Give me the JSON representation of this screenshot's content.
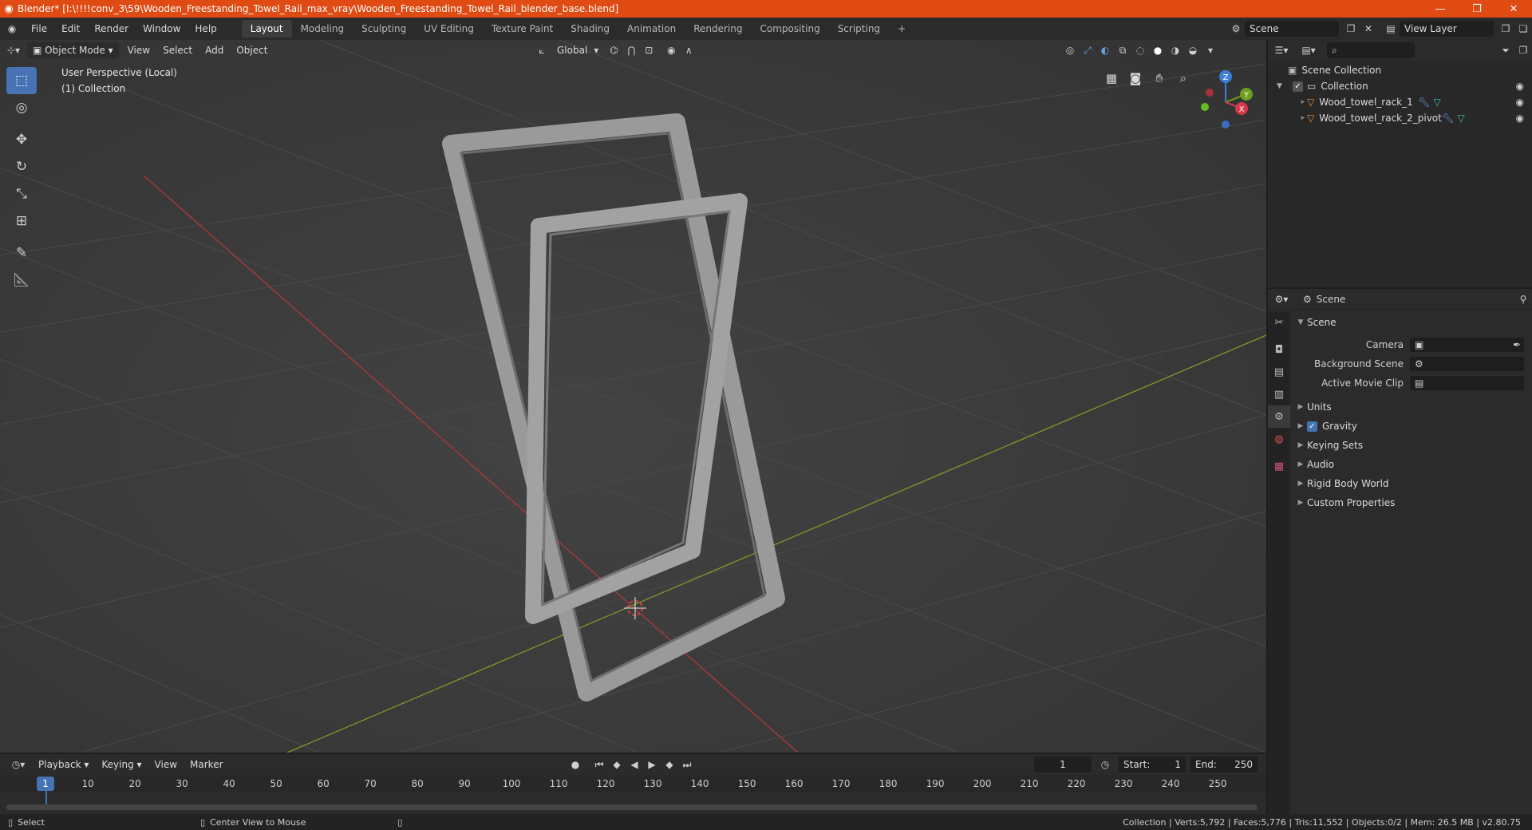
{
  "window": {
    "title": "Blender* [I:\\!!!!conv_3\\59\\Wooden_Freestanding_Towel_Rail_max_vray\\Wooden_Freestanding_Towel_Rail_blender_base.blend]",
    "minimize": "—",
    "maximize": "❐",
    "close": "✕"
  },
  "menu": [
    "File",
    "Edit",
    "Render",
    "Window",
    "Help"
  ],
  "workspaces": [
    "Layout",
    "Modeling",
    "Sculpting",
    "UV Editing",
    "Texture Paint",
    "Shading",
    "Animation",
    "Rendering",
    "Compositing",
    "Scripting"
  ],
  "active_workspace": "Layout",
  "add_workspace": "+",
  "scene_field": "Scene",
  "view_layer_field": "View Layer",
  "viewport": {
    "mode": "Object Mode",
    "menus": [
      "View",
      "Select",
      "Add",
      "Object"
    ],
    "transform_orientation": "Global",
    "info_line1": "User Perspective (Local)",
    "info_line2": "(1) Collection",
    "gizmo": {
      "z": "Z",
      "y": "Y",
      "x": "X"
    }
  },
  "outliner": {
    "root": "Scene Collection",
    "collection": "Collection",
    "objects": [
      "Wood_towel_rack_1",
      "Wood_towel_rack_2_pivot"
    ]
  },
  "properties": {
    "header": "Scene",
    "panel": "Scene",
    "rows": [
      {
        "label": "Camera",
        "value": ""
      },
      {
        "label": "Background Scene",
        "value": ""
      },
      {
        "label": "Active Movie Clip",
        "value": ""
      }
    ],
    "subpanels": [
      "Units",
      "Gravity",
      "Keying Sets",
      "Audio",
      "Rigid Body World",
      "Custom Properties"
    ]
  },
  "timeline": {
    "menus": [
      "Playback",
      "Keying",
      "View",
      "Marker"
    ],
    "current_frame": "1",
    "start_label": "Start:",
    "start": "1",
    "end_label": "End:",
    "end": "250",
    "ticks": [
      "1",
      "10",
      "20",
      "30",
      "40",
      "50",
      "60",
      "70",
      "80",
      "90",
      "100",
      "110",
      "120",
      "130",
      "140",
      "150",
      "160",
      "170",
      "180",
      "190",
      "200",
      "210",
      "220",
      "230",
      "240",
      "250"
    ]
  },
  "status": {
    "left1": "Select",
    "left2": "Center View to Mouse",
    "right": "Collection | Verts:5,792 | Faces:5,776 | Tris:11,552 | Objects:0/2 | Mem: 26.5 MB | v2.80.75"
  },
  "colors": {
    "accent": "#4772b3",
    "titlebar": "#e04a13",
    "axis_x": "#c83a3a",
    "axis_y": "#7ea12a",
    "gizmo_z": "#3d7ed8",
    "gizmo_y": "#6f9e20",
    "gizmo_x": "#d63a4a"
  }
}
